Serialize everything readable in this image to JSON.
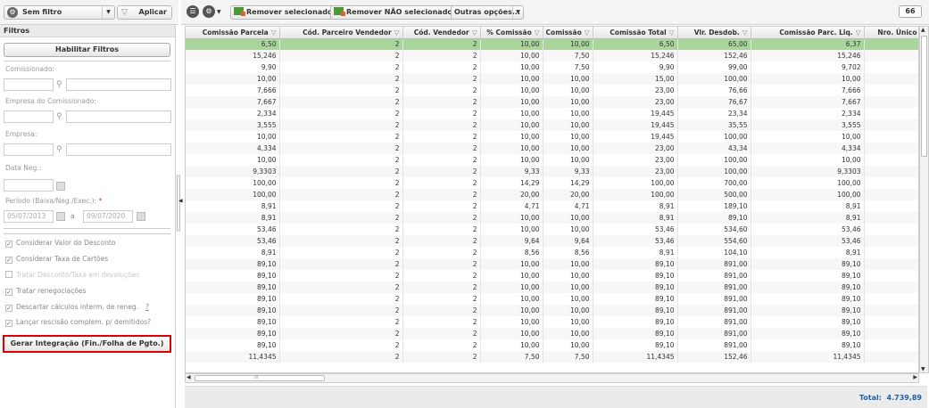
{
  "left_toolbar": {
    "filter_select": "Sem filtro",
    "apply_label": "Aplicar"
  },
  "filters": {
    "header": "Filtros",
    "enable_button": "Habilitar Filtros",
    "comissionado_label": "Comissionado:",
    "empresa_comissionado_label": "Empresa do Comissionado:",
    "empresa_label": "Empresa:",
    "data_neg_label": "Data Neg.:",
    "periodo_label": "Período (Baixa/Neg./Exec.):",
    "periodo_required": "*",
    "date_from": "05/07/2013",
    "date_sep": "a",
    "date_to": "09/07/2020",
    "checks": [
      {
        "label": "Considerar Valor do Desconto",
        "checked": true,
        "disabled": false
      },
      {
        "label": "Considerar Taxa de Cartões",
        "checked": true,
        "disabled": false
      },
      {
        "label": "Tratar Desconto/Taxa em devoluções",
        "checked": false,
        "disabled": true
      },
      {
        "label": "Tratar renegociações",
        "checked": true,
        "disabled": false
      },
      {
        "label": "Descartar cálculos interm. de reneg.",
        "checked": true,
        "disabled": false
      },
      {
        "label": "Lançar rescisão complem. p/ demitidos?",
        "checked": true,
        "disabled": false
      }
    ],
    "descartar_suffix": "?",
    "gerar_button": "Gerar Integração (Fin./Folha de Pgto.)"
  },
  "toolbar": {
    "remove_selected": "Remover selecionados",
    "remove_not_selected": "Remover NÃO selecionados",
    "more_options": "Outras opções...",
    "count": "66"
  },
  "grid": {
    "columns": [
      "Comissão Parcela",
      "Cód. Parceiro Vendedor",
      "Cód. Vendedor",
      "% Comissão",
      "Comissão",
      "Comissão Total",
      "Vlr. Desdob.",
      "Comissão Parc. Liq.",
      "Nro. Único"
    ],
    "rows": [
      [
        "6,50",
        "2",
        "2",
        "10,00",
        "10,00",
        "6,50",
        "65,00",
        "6,37",
        ""
      ],
      [
        "15,246",
        "2",
        "2",
        "10,00",
        "7,50",
        "15,246",
        "152,46",
        "15,246",
        ""
      ],
      [
        "9,90",
        "2",
        "2",
        "10,00",
        "7,50",
        "9,90",
        "99,00",
        "9,702",
        ""
      ],
      [
        "10,00",
        "2",
        "2",
        "10,00",
        "10,00",
        "15,00",
        "100,00",
        "10,00",
        ""
      ],
      [
        "7,666",
        "2",
        "2",
        "10,00",
        "10,00",
        "23,00",
        "76,66",
        "7,666",
        ""
      ],
      [
        "7,667",
        "2",
        "2",
        "10,00",
        "10,00",
        "23,00",
        "76,67",
        "7,667",
        ""
      ],
      [
        "2,334",
        "2",
        "2",
        "10,00",
        "10,00",
        "19,445",
        "23,34",
        "2,334",
        ""
      ],
      [
        "3,555",
        "2",
        "2",
        "10,00",
        "10,00",
        "19,445",
        "35,55",
        "3,555",
        ""
      ],
      [
        "10,00",
        "2",
        "2",
        "10,00",
        "10,00",
        "19,445",
        "100,00",
        "10,00",
        ""
      ],
      [
        "4,334",
        "2",
        "2",
        "10,00",
        "10,00",
        "23,00",
        "43,34",
        "4,334",
        ""
      ],
      [
        "10,00",
        "2",
        "2",
        "10,00",
        "10,00",
        "23,00",
        "100,00",
        "10,00",
        ""
      ],
      [
        "9,3303",
        "2",
        "2",
        "9,33",
        "9,33",
        "23,00",
        "100,00",
        "9,3303",
        ""
      ],
      [
        "100,00",
        "2",
        "2",
        "14,29",
        "14,29",
        "100,00",
        "700,00",
        "100,00",
        ""
      ],
      [
        "100,00",
        "2",
        "2",
        "20,00",
        "20,00",
        "100,00",
        "500,00",
        "100,00",
        ""
      ],
      [
        "8,91",
        "2",
        "2",
        "4,71",
        "4,71",
        "8,91",
        "189,10",
        "8,91",
        ""
      ],
      [
        "8,91",
        "2",
        "2",
        "10,00",
        "10,00",
        "8,91",
        "89,10",
        "8,91",
        ""
      ],
      [
        "53,46",
        "2",
        "2",
        "10,00",
        "10,00",
        "53,46",
        "534,60",
        "53,46",
        ""
      ],
      [
        "53,46",
        "2",
        "2",
        "9,64",
        "9,64",
        "53,46",
        "554,60",
        "53,46",
        ""
      ],
      [
        "8,91",
        "2",
        "2",
        "8,56",
        "8,56",
        "8,91",
        "104,10",
        "8,91",
        ""
      ],
      [
        "89,10",
        "2",
        "2",
        "10,00",
        "10,00",
        "89,10",
        "891,00",
        "89,10",
        ""
      ],
      [
        "89,10",
        "2",
        "2",
        "10,00",
        "10,00",
        "89,10",
        "891,00",
        "89,10",
        ""
      ],
      [
        "89,10",
        "2",
        "2",
        "10,00",
        "10,00",
        "89,10",
        "891,00",
        "89,10",
        ""
      ],
      [
        "89,10",
        "2",
        "2",
        "10,00",
        "10,00",
        "89,10",
        "891,00",
        "89,10",
        ""
      ],
      [
        "89,10",
        "2",
        "2",
        "10,00",
        "10,00",
        "89,10",
        "891,00",
        "89,10",
        ""
      ],
      [
        "89,10",
        "2",
        "2",
        "10,00",
        "10,00",
        "89,10",
        "891,00",
        "89,10",
        ""
      ],
      [
        "89,10",
        "2",
        "2",
        "10,00",
        "10,00",
        "89,10",
        "891,00",
        "89,10",
        ""
      ],
      [
        "89,10",
        "2",
        "2",
        "10,00",
        "10,00",
        "89,10",
        "891,00",
        "89,10",
        ""
      ],
      [
        "11,4345",
        "2",
        "2",
        "7,50",
        "7,50",
        "11,4345",
        "152,46",
        "11,4345",
        ""
      ]
    ],
    "selected_row": 0,
    "scroll_marker": "III"
  },
  "footer": {
    "total_label": "Total:",
    "total_value": "4.739,89"
  },
  "colors": {
    "selected_row": "#a9d59c",
    "highlight_border": "#dd0000",
    "total_text": "#1f5fa8"
  }
}
